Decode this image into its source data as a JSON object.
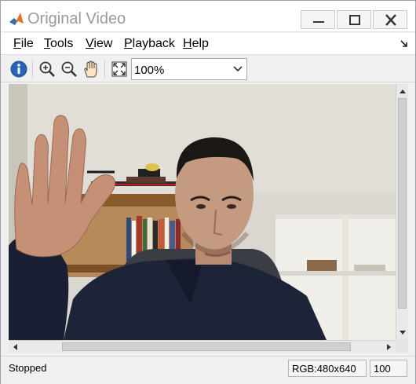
{
  "window": {
    "title": "Original Video",
    "minimize_icon": "minimize-icon",
    "maximize_icon": "maximize-icon",
    "close_icon": "close-icon"
  },
  "menu": {
    "items": [
      {
        "label": "File",
        "underline": "F",
        "rest": "ile"
      },
      {
        "label": "Tools",
        "underline": "T",
        "rest": "ools"
      },
      {
        "label": "View",
        "underline": "V",
        "rest": "iew"
      },
      {
        "label": "Playback",
        "underline": "P",
        "rest": "layback"
      },
      {
        "label": "Help",
        "underline": "H",
        "rest": "elp"
      }
    ],
    "dock_icon": "dock-arrow-icon"
  },
  "toolbar": {
    "icons": [
      "info-icon",
      "zoom-in-icon",
      "zoom-out-icon",
      "pan-hand-icon",
      "fit-to-window-icon"
    ],
    "zoom_value": "100%"
  },
  "status": {
    "state": "Stopped",
    "color_info": "RGB:480x640",
    "zoom_readout": "100"
  }
}
